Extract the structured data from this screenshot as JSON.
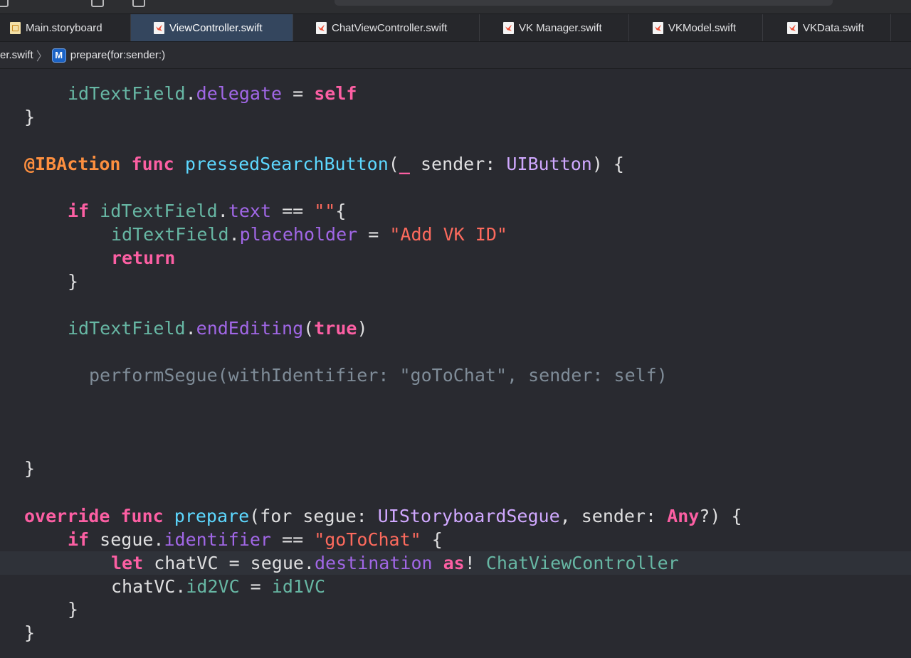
{
  "tabs": [
    {
      "label": "Main.storyboard",
      "icon": "storyboard-file-icon",
      "active": false
    },
    {
      "label": "ViewController.swift",
      "icon": "swift-file-icon",
      "active": true
    },
    {
      "label": "ChatViewController.swift",
      "icon": "swift-file-icon",
      "active": false
    },
    {
      "label": "VK Manager.swift",
      "icon": "swift-file-icon",
      "active": false
    },
    {
      "label": "VKModel.swift",
      "icon": "swift-file-icon",
      "active": false
    },
    {
      "label": "VKData.swift",
      "icon": "swift-file-icon",
      "active": false
    }
  ],
  "jumpbar": {
    "file": "er.swift",
    "method_badge": "M",
    "method": "prepare(for:sender:)"
  },
  "code": {
    "l1": {
      "a": "idTextField",
      "b": ".",
      "c": "delegate",
      "d": " = ",
      "e": "self"
    },
    "l2": "}",
    "l3": {
      "a": "@IBAction",
      "b": " ",
      "c": "func",
      "d": " ",
      "e": "pressedSearchButton",
      "f": "(",
      "g": "_",
      "h": " sender: ",
      "i": "UIButton",
      "j": ") {"
    },
    "l4": {
      "a": "if",
      "b": " ",
      "c": "idTextField",
      "d": ".",
      "e": "text",
      "f": " == ",
      "g": "\"\"",
      "h": "{"
    },
    "l5": {
      "a": "idTextField",
      "b": ".",
      "c": "placeholder",
      "d": " = ",
      "e": "\"Add VK ID\""
    },
    "l6": "return",
    "l7": "}",
    "l8": {
      "a": "idTextField",
      "b": ".",
      "c": "endEditing",
      "d": "(",
      "e": "true",
      "f": ")"
    },
    "l9": "performSegue(withIdentifier: \"goToChat\", sender: self)",
    "l10": "}",
    "l11": {
      "a": "override",
      "b": " ",
      "c": "func",
      "d": " ",
      "e": "prepare",
      "f": "(for segue: ",
      "g": "UIStoryboardSegue",
      "h": ", sender: ",
      "i": "Any",
      "j": "?) {"
    },
    "l12": {
      "a": "if",
      "b": " segue.",
      "c": "identifier",
      "d": " == ",
      "e": "\"goToChat\"",
      "f": " {"
    },
    "l13": {
      "a": "let",
      "b": " chatVC = segue.",
      "c": "destination",
      "d": " ",
      "e": "as",
      "f": "! ",
      "g": "ChatViewController"
    },
    "l14": {
      "a": "chatVC.",
      "b": "id2VC",
      "c": " = ",
      "d": "id1VC"
    },
    "l15": "}",
    "l16": "}"
  },
  "colors": {
    "background": "#292a30",
    "keyword": "#fc5fa3",
    "string": "#fc6a5d",
    "project_identifier": "#67b7a4",
    "type": "#d0a8ff",
    "property": "#a167e6",
    "function": "#5dd8ff",
    "active_tab": "#34465e"
  }
}
